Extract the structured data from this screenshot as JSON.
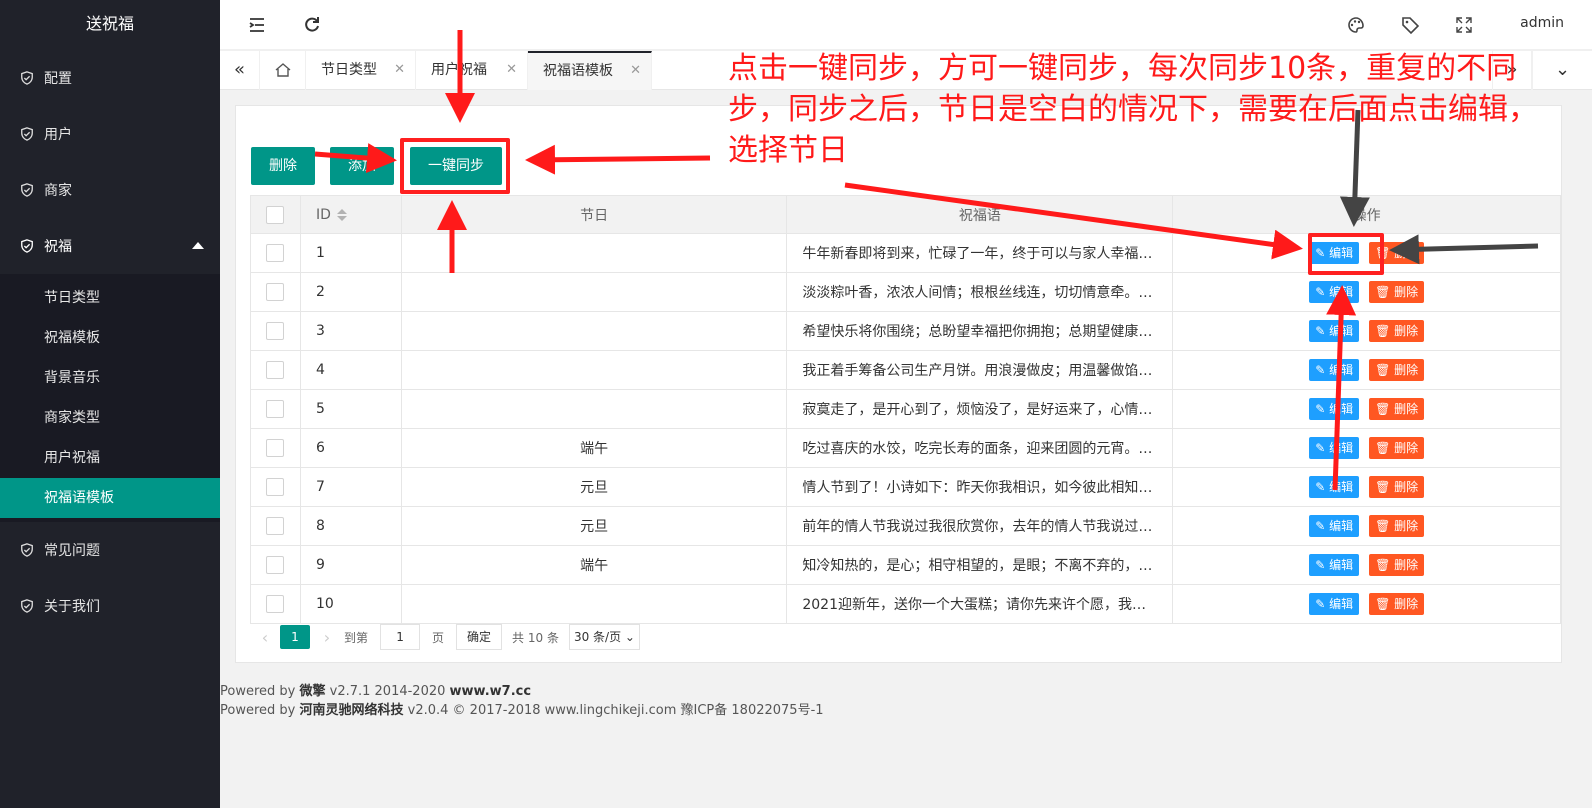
{
  "app": {
    "title": "送祝福"
  },
  "sidebar": {
    "items": [
      {
        "label": "配置"
      },
      {
        "label": "用户"
      },
      {
        "label": "商家"
      },
      {
        "label": "祝福"
      },
      {
        "label": "常见问题"
      },
      {
        "label": "关于我们"
      }
    ],
    "sub_items": [
      {
        "label": "节日类型"
      },
      {
        "label": "祝福模板"
      },
      {
        "label": "背景音乐"
      },
      {
        "label": "商家类型"
      },
      {
        "label": "用户祝福"
      },
      {
        "label": "祝福语模板"
      }
    ]
  },
  "header": {
    "user": "admin"
  },
  "tabs": [
    {
      "label": "节日类型"
    },
    {
      "label": "用户祝福"
    },
    {
      "label": "祝福语模板"
    }
  ],
  "toolbar": {
    "delete_label": "删除",
    "add_label": "添加",
    "sync_label": "一键同步"
  },
  "table": {
    "headers": {
      "id": "ID",
      "festival": "节日",
      "greeting": "祝福语",
      "actions": "操作"
    },
    "edit_label": "编辑",
    "delete_label": "删除",
    "rows": [
      {
        "id": "1",
        "festival": "",
        "greeting": "牛年新春即将到来，忙碌了一年，终于可以与家人幸福…"
      },
      {
        "id": "2",
        "festival": "",
        "greeting": "淡淡粽叶香，浓浓人间情；根根丝线连，切切情意牵。…"
      },
      {
        "id": "3",
        "festival": "",
        "greeting": "希望快乐将你围绕；总盼望幸福把你拥抱；总期望健康…"
      },
      {
        "id": "4",
        "festival": "",
        "greeting": "我正着手筹备公司生产月饼。用浪漫做皮；用温馨做馅…"
      },
      {
        "id": "5",
        "festival": "",
        "greeting": "寂寞走了，是开心到了，烦恼没了，是好运来了，心情…"
      },
      {
        "id": "6",
        "festival": "端午",
        "greeting": "吃过喜庆的水饺，吃完长寿的面条，迎来团圆的元宵。…"
      },
      {
        "id": "7",
        "festival": "元旦",
        "greeting": "情人节到了！小诗如下：昨天你我相识，如今彼此相知…"
      },
      {
        "id": "8",
        "festival": "元旦",
        "greeting": "前年的情人节我说过我很欣赏你，去年的情人节我说过…"
      },
      {
        "id": "9",
        "festival": "端午",
        "greeting": "知冷知热的，是心；相守相望的，是眼；不离不弃的，…"
      },
      {
        "id": "10",
        "festival": "",
        "greeting": "2021迎新年，送你一个大蛋糕；请你先来许个愿，我再…"
      }
    ]
  },
  "pager": {
    "current": "1",
    "goto_label": "到第",
    "page_input": "1",
    "page_unit": "页",
    "confirm_label": "确定",
    "total": "共 10 条",
    "page_size": "30 条/页"
  },
  "footer": {
    "line1_prefix": "Powered by ",
    "line1_brand": "微擎",
    "line1_version": " v2.7.1 2014-2020 ",
    "line1_site": "www.w7.cc",
    "line2_prefix": "Powered by ",
    "line2_brand": "河南灵驰网络科技",
    "line2_rest": " v2.0.4 © 2017-2018 www.lingchikeji.com 豫ICP备 18022075号-1"
  },
  "annotation": {
    "text": "点击一键同步，方可一键同步，每次同步10条，重复的不同步，同步之后，节日是空白的情况下，需要在后面点击编辑，选择节日",
    "color": "#ff1a1a"
  },
  "colors": {
    "primary": "#009688",
    "sidebar": "#20222a",
    "edit": "#1e9fff",
    "delete": "#ff5722"
  }
}
